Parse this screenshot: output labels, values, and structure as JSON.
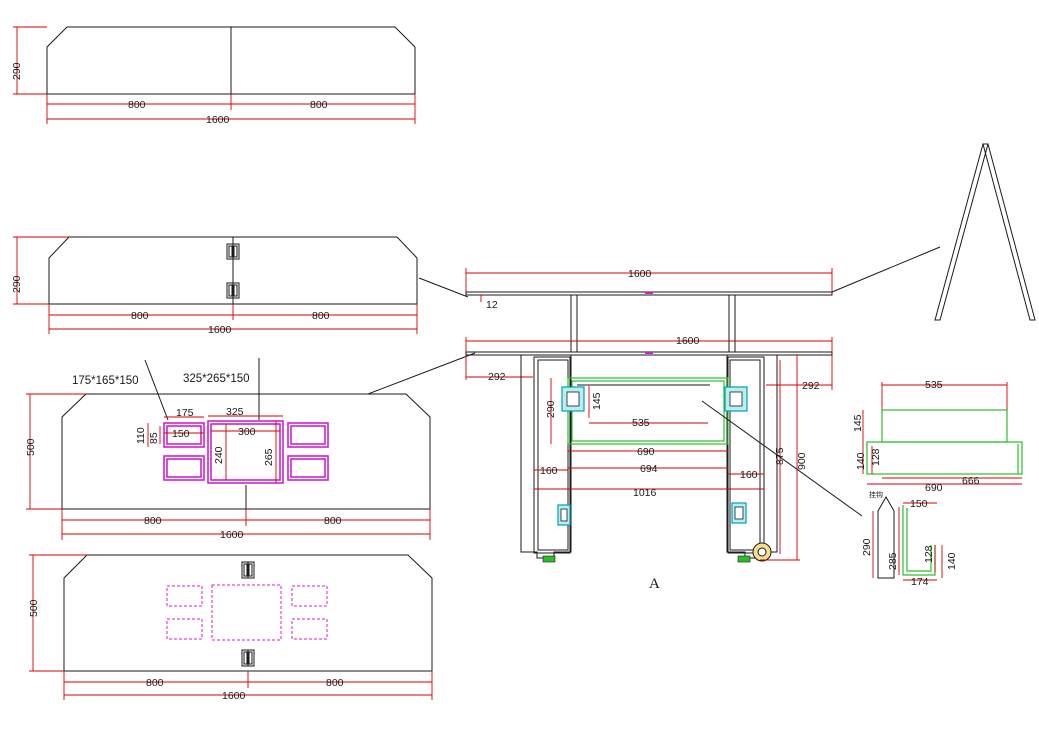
{
  "view1": {
    "height": "290",
    "left_width": "800",
    "right_width": "800",
    "total_width": "1600"
  },
  "view2": {
    "height": "290",
    "left_width": "800",
    "right_width": "800",
    "total_width": "1600"
  },
  "view3": {
    "height": "500",
    "small_box_label": "175*165*150",
    "large_box_label": "325*265*150",
    "d175": "175",
    "d150": "150",
    "d110": "110",
    "d85": "85",
    "d325": "325",
    "d300": "300",
    "d240": "240",
    "d265": "265",
    "left_width": "800",
    "right_width": "800",
    "total_width": "1600"
  },
  "view4": {
    "height": "500",
    "left_width": "800",
    "right_width": "800",
    "total_width": "1600"
  },
  "front": {
    "top_width": "1600",
    "gap": "12",
    "second_width": "1600",
    "left_overhang": "292",
    "right_overhang": "292",
    "d290": "290",
    "d145": "145",
    "d535": "535",
    "d690": "690",
    "d694": "694",
    "d1016": "1016",
    "d160_left": "160",
    "d160_right": "160",
    "d875": "875",
    "d900": "900",
    "view_label": "A"
  },
  "side": {
    "d535": "535",
    "d145": "145",
    "d140": "140",
    "d128": "128",
    "d690": "690",
    "d666": "666"
  },
  "bracket": {
    "note": "挂钩",
    "d150": "150",
    "d290": "290",
    "d285": "285",
    "d128": "128",
    "d140": "140",
    "d174": "174"
  },
  "colors": {
    "outline": "#1a1a1a",
    "dimension": "#d40000",
    "drawer": "#2ac02a",
    "box": "#d020d0",
    "hinge": "#00a0b0"
  }
}
